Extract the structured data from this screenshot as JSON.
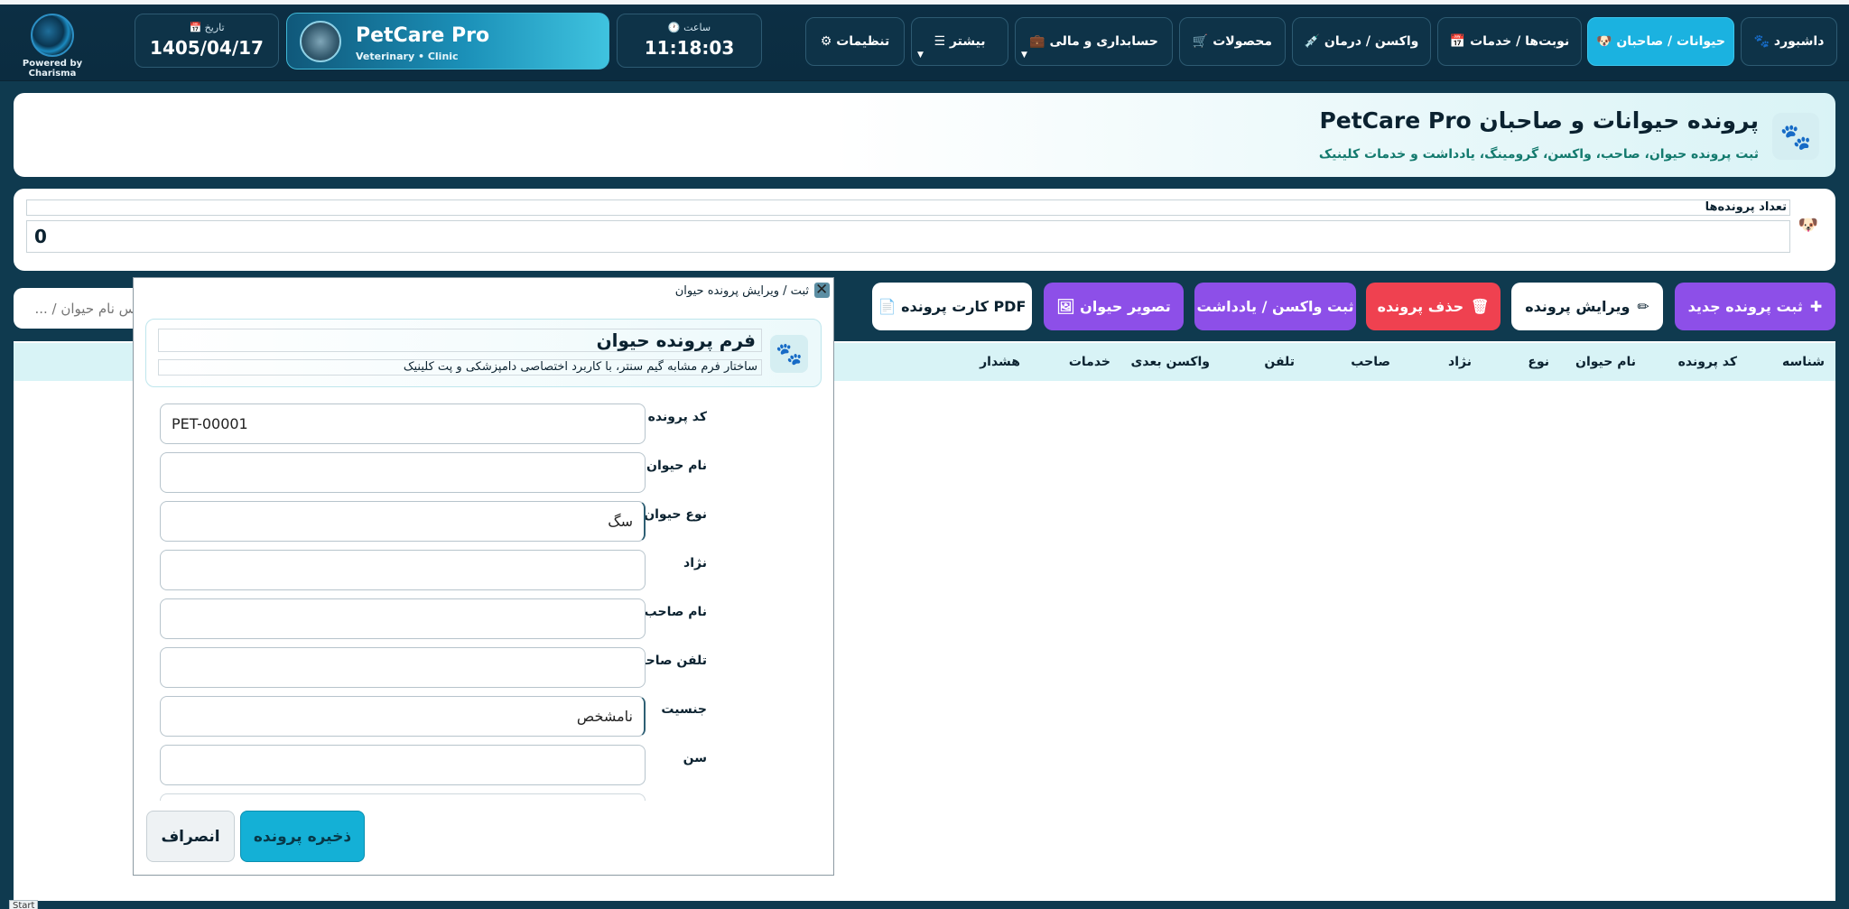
{
  "app": {
    "powered_by": "Powered by Charisma",
    "date_label": "📅 تاریخ",
    "date_value": "1405/04/17",
    "brand_title": "PetCare Pro",
    "brand_subtitle": "Veterinary • Clinic",
    "time_label": "🕐 ساعت",
    "time_value": "11:18:03"
  },
  "nav": [
    {
      "label": "🐾 داشبورد"
    },
    {
      "label": "🐶 حیوانات / صاحبان"
    },
    {
      "label": "📅 نوبت‌ها / خدمات"
    },
    {
      "label": "💉 واکسن / درمان"
    },
    {
      "label": "🛒 محصولات"
    },
    {
      "label": "💼 حسابداری و مالی"
    },
    {
      "label": "☰ بیشتر"
    },
    {
      "label": "⚙ تنظیمات"
    }
  ],
  "header": {
    "title": "پرونده حیوانات و صاحبان PetCare Pro",
    "subtitle": "ثبت پرونده حیوان، صاحب، واکسن، گرومینگ، یادداشت و خدمات کلینیک"
  },
  "stats": {
    "label": "تعداد پرونده‌ها",
    "value": "0"
  },
  "search": {
    "placeholder": "س نام حیوان / ..."
  },
  "actions": {
    "new_record": "ثبت پرونده جدید",
    "edit_record": "ویرایش پرونده",
    "delete_record": "حذف پرونده",
    "vaccine_note": "ثبت واکسن / یادداشت",
    "pet_image": "🖼 تصویر حیوان",
    "pdf_card": "📄 کارت پرونده PDF"
  },
  "table": {
    "columns": [
      "شناسه",
      "کد پرونده",
      "نام حیوان",
      "نوع",
      "نژاد",
      "صاحب",
      "تلفن",
      "واکسن بعدی",
      "خدمات",
      "هشدار"
    ]
  },
  "modal": {
    "title": "ثبت / ویرایش پرونده حیوان",
    "form_title": "فرم پرونده حیوان",
    "form_subtitle": "ساختار فرم مشابه گیم سنتر، با کاربرد اختصاصی دامپزشکی و پت کلینیک",
    "fields": [
      {
        "label": "کد پرونده",
        "value": "PET-00001"
      },
      {
        "label": "نام حیوان",
        "value": ""
      },
      {
        "label": "نوع حیوان",
        "value": "سگ"
      },
      {
        "label": "نژاد",
        "value": ""
      },
      {
        "label": "نام صاحب",
        "value": ""
      },
      {
        "label": "تلفن صاحب",
        "value": ""
      },
      {
        "label": "جنسیت",
        "value": "نامشخص"
      },
      {
        "label": "سن",
        "value": ""
      }
    ],
    "save_label": "ذخیره پرونده",
    "cancel_label": "انصراف"
  },
  "taskbar": {
    "start_label": "Start"
  },
  "colors": {
    "accent": "#1bb2e0",
    "purple": "#8d4fe8",
    "danger": "#ef4150",
    "header_bg": "#0c2f44"
  }
}
